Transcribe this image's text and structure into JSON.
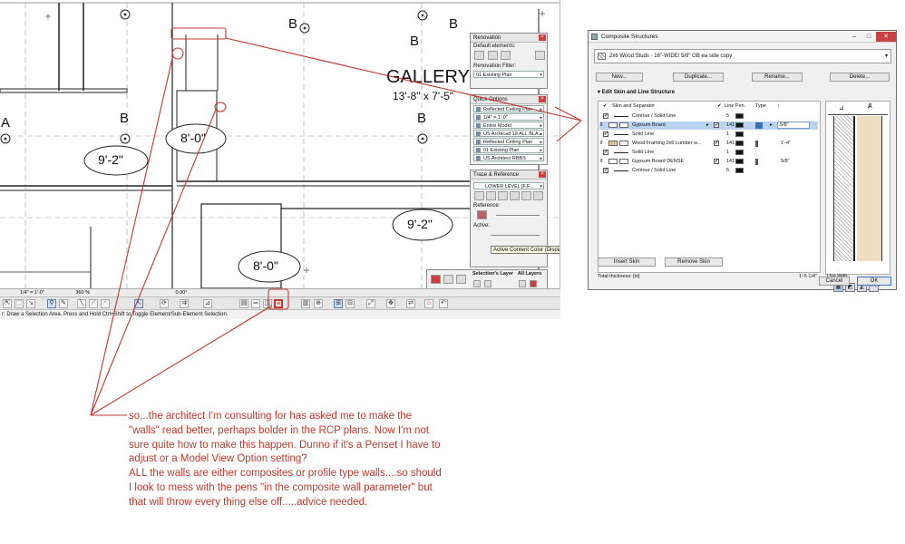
{
  "plan": {
    "room_name": "GALLERY",
    "room_size": "13'-8\" x 7'-5\"",
    "ceiling_tags": [
      "9'-2\"",
      "8'-0\"",
      "9'-2\"",
      "8'-0\""
    ],
    "grid_letters": [
      "B",
      "B",
      "B",
      "B",
      "B",
      "A"
    ]
  },
  "renovation_palette": {
    "title": "Renovation",
    "default_elements_label": "Default elements:",
    "filter_label": "Renovation Filter:",
    "filter_value": "01 Existing Plan"
  },
  "quick_options_palette": {
    "title": "Quick Options",
    "rows": [
      "Reflected Ceiling Plan",
      "1/4\" = 1'-0\"",
      "Entire Model",
      "US Archicad 18 ALL BLA...",
      "Reflected Ceiling Plan",
      "01 Existing Plan",
      "US Architect RBBS"
    ]
  },
  "trace_palette": {
    "title": "Trace & Reference",
    "level_field": "LOWER LEVEL [F.F...",
    "reference_label": "Reference:",
    "active_label": "Active:",
    "tooltip": "Active Content Color (Display"
  },
  "layers_bar": {
    "selections_layer": "Selection's Layer",
    "all_layers": "All Layers"
  },
  "toolbar": {
    "scale": "1/4\" = 1'-0\"",
    "zoom": "360 %",
    "angle": "0.00°"
  },
  "status_bar": {
    "text": "r: Draw a Selection Area. Press and Hold Ctrl+Shift to Toggle Element/Sub-Element Selection."
  },
  "dialog": {
    "title": "Composite Structures",
    "composite_name": "2x6 Wood Studs - 16\"-WIDE/ 5/8\" GB ea side copy",
    "buttons": {
      "new": "New...",
      "duplicate": "Duplicate...",
      "rename": "Rename...",
      "delete": "Delete...",
      "insert_skin": "Insert Skin",
      "remove_skin": "Remove Skin",
      "cancel": "Cancel",
      "ok": "OK"
    },
    "section_title": "Edit Skin and Line Structure",
    "columns": {
      "skin": "Skin and Separator",
      "line_pen": "Line Pen",
      "type": "Type"
    },
    "rows": [
      {
        "name": "Contour / Solid Line",
        "pen": "5",
        "thickness": ""
      },
      {
        "name": "Gypsum Board",
        "pen": "141",
        "thickness": "5/8\""
      },
      {
        "name": "Solid Line",
        "pen": "1",
        "thickness": ""
      },
      {
        "name": "Wood Framing 2x6 Lumber w...",
        "pen": "141",
        "thickness": "1'-4\""
      },
      {
        "name": "Solid Line",
        "pen": "1",
        "thickness": ""
      },
      {
        "name": "Gypsum Board DENSE",
        "pen": "141",
        "thickness": "5/8\""
      },
      {
        "name": "Contour / Solid Line",
        "pen": "5",
        "thickness": ""
      }
    ],
    "total_label": "Total thickness: [in]",
    "total_value": "1'-5 1/4\"",
    "use_with": "Use With:"
  },
  "note": [
    "so...the architect I'm consulting for has asked me to make the",
    "\"walls\" read better, perhaps bolder in the RCP plans. Now I'm not",
    "sure quite how to make this happen. Dunno if it's a Penset I have to",
    "adjust or a Model View Option setting?",
    "ALL the walls are either composites or profile type walls....so should",
    "I look to mess with the pens \"in the composite wall parameter\" but",
    "that will throw every thing else off.....advice needed."
  ],
  "colors": {
    "annotation": "#c0392b",
    "selection": "#b9d3f0",
    "gypsum_fill": "#f0dcc0"
  }
}
